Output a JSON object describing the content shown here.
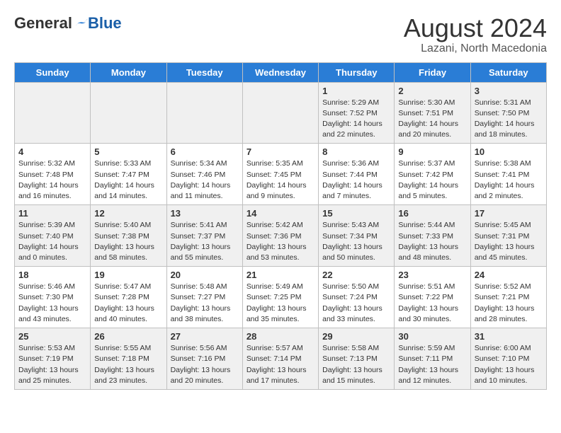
{
  "header": {
    "logo_general": "General",
    "logo_blue": "Blue",
    "month_year": "August 2024",
    "location": "Lazani, North Macedonia"
  },
  "weekdays": [
    "Sunday",
    "Monday",
    "Tuesday",
    "Wednesday",
    "Thursday",
    "Friday",
    "Saturday"
  ],
  "weeks": [
    [
      {
        "day": "",
        "info": ""
      },
      {
        "day": "",
        "info": ""
      },
      {
        "day": "",
        "info": ""
      },
      {
        "day": "",
        "info": ""
      },
      {
        "day": "1",
        "info": "Sunrise: 5:29 AM\nSunset: 7:52 PM\nDaylight: 14 hours\nand 22 minutes."
      },
      {
        "day": "2",
        "info": "Sunrise: 5:30 AM\nSunset: 7:51 PM\nDaylight: 14 hours\nand 20 minutes."
      },
      {
        "day": "3",
        "info": "Sunrise: 5:31 AM\nSunset: 7:50 PM\nDaylight: 14 hours\nand 18 minutes."
      }
    ],
    [
      {
        "day": "4",
        "info": "Sunrise: 5:32 AM\nSunset: 7:48 PM\nDaylight: 14 hours\nand 16 minutes."
      },
      {
        "day": "5",
        "info": "Sunrise: 5:33 AM\nSunset: 7:47 PM\nDaylight: 14 hours\nand 14 minutes."
      },
      {
        "day": "6",
        "info": "Sunrise: 5:34 AM\nSunset: 7:46 PM\nDaylight: 14 hours\nand 11 minutes."
      },
      {
        "day": "7",
        "info": "Sunrise: 5:35 AM\nSunset: 7:45 PM\nDaylight: 14 hours\nand 9 minutes."
      },
      {
        "day": "8",
        "info": "Sunrise: 5:36 AM\nSunset: 7:44 PM\nDaylight: 14 hours\nand 7 minutes."
      },
      {
        "day": "9",
        "info": "Sunrise: 5:37 AM\nSunset: 7:42 PM\nDaylight: 14 hours\nand 5 minutes."
      },
      {
        "day": "10",
        "info": "Sunrise: 5:38 AM\nSunset: 7:41 PM\nDaylight: 14 hours\nand 2 minutes."
      }
    ],
    [
      {
        "day": "11",
        "info": "Sunrise: 5:39 AM\nSunset: 7:40 PM\nDaylight: 14 hours\nand 0 minutes."
      },
      {
        "day": "12",
        "info": "Sunrise: 5:40 AM\nSunset: 7:38 PM\nDaylight: 13 hours\nand 58 minutes."
      },
      {
        "day": "13",
        "info": "Sunrise: 5:41 AM\nSunset: 7:37 PM\nDaylight: 13 hours\nand 55 minutes."
      },
      {
        "day": "14",
        "info": "Sunrise: 5:42 AM\nSunset: 7:36 PM\nDaylight: 13 hours\nand 53 minutes."
      },
      {
        "day": "15",
        "info": "Sunrise: 5:43 AM\nSunset: 7:34 PM\nDaylight: 13 hours\nand 50 minutes."
      },
      {
        "day": "16",
        "info": "Sunrise: 5:44 AM\nSunset: 7:33 PM\nDaylight: 13 hours\nand 48 minutes."
      },
      {
        "day": "17",
        "info": "Sunrise: 5:45 AM\nSunset: 7:31 PM\nDaylight: 13 hours\nand 45 minutes."
      }
    ],
    [
      {
        "day": "18",
        "info": "Sunrise: 5:46 AM\nSunset: 7:30 PM\nDaylight: 13 hours\nand 43 minutes."
      },
      {
        "day": "19",
        "info": "Sunrise: 5:47 AM\nSunset: 7:28 PM\nDaylight: 13 hours\nand 40 minutes."
      },
      {
        "day": "20",
        "info": "Sunrise: 5:48 AM\nSunset: 7:27 PM\nDaylight: 13 hours\nand 38 minutes."
      },
      {
        "day": "21",
        "info": "Sunrise: 5:49 AM\nSunset: 7:25 PM\nDaylight: 13 hours\nand 35 minutes."
      },
      {
        "day": "22",
        "info": "Sunrise: 5:50 AM\nSunset: 7:24 PM\nDaylight: 13 hours\nand 33 minutes."
      },
      {
        "day": "23",
        "info": "Sunrise: 5:51 AM\nSunset: 7:22 PM\nDaylight: 13 hours\nand 30 minutes."
      },
      {
        "day": "24",
        "info": "Sunrise: 5:52 AM\nSunset: 7:21 PM\nDaylight: 13 hours\nand 28 minutes."
      }
    ],
    [
      {
        "day": "25",
        "info": "Sunrise: 5:53 AM\nSunset: 7:19 PM\nDaylight: 13 hours\nand 25 minutes."
      },
      {
        "day": "26",
        "info": "Sunrise: 5:55 AM\nSunset: 7:18 PM\nDaylight: 13 hours\nand 23 minutes."
      },
      {
        "day": "27",
        "info": "Sunrise: 5:56 AM\nSunset: 7:16 PM\nDaylight: 13 hours\nand 20 minutes."
      },
      {
        "day": "28",
        "info": "Sunrise: 5:57 AM\nSunset: 7:14 PM\nDaylight: 13 hours\nand 17 minutes."
      },
      {
        "day": "29",
        "info": "Sunrise: 5:58 AM\nSunset: 7:13 PM\nDaylight: 13 hours\nand 15 minutes."
      },
      {
        "day": "30",
        "info": "Sunrise: 5:59 AM\nSunset: 7:11 PM\nDaylight: 13 hours\nand 12 minutes."
      },
      {
        "day": "31",
        "info": "Sunrise: 6:00 AM\nSunset: 7:10 PM\nDaylight: 13 hours\nand 10 minutes."
      }
    ]
  ]
}
